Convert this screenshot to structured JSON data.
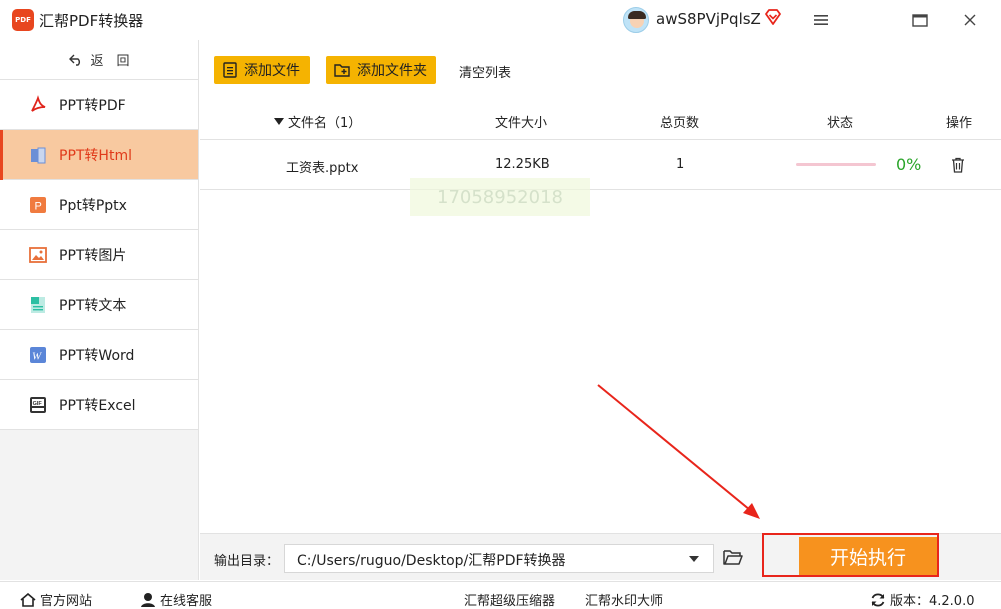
{
  "app": {
    "title": "汇帮PDF转换器",
    "logo_text": "PDF"
  },
  "user": {
    "name": "awS8PVjPqlsZ"
  },
  "sidebar": {
    "back_label": "返　回",
    "items": [
      {
        "label": "PPT转PDF",
        "icon": "pdf-icon"
      },
      {
        "label": "PPT转Html",
        "icon": "html-icon",
        "active": true
      },
      {
        "label": "Ppt转Pptx",
        "icon": "pptx-icon"
      },
      {
        "label": "PPT转图片",
        "icon": "image-icon"
      },
      {
        "label": "PPT转文本",
        "icon": "text-icon"
      },
      {
        "label": "PPT转Word",
        "icon": "word-icon"
      },
      {
        "label": "PPT转Excel",
        "icon": "excel-icon"
      }
    ]
  },
  "toolbar": {
    "add_file": "添加文件",
    "add_folder": "添加文件夹",
    "clear_list": "清空列表"
  },
  "table": {
    "headers": {
      "name": "文件名（1）",
      "size": "文件大小",
      "pages": "总页数",
      "status": "状态",
      "action": "操作"
    },
    "rows": [
      {
        "name": "工资表.pptx",
        "size": "12.25KB",
        "pages": "1",
        "progress": 0,
        "percent": "0%"
      }
    ]
  },
  "watermark": "17058952018",
  "output": {
    "label": "输出目录：",
    "path": "C:/Users/ruguo/Desktop/汇帮PDF转换器"
  },
  "start_button": "开始执行",
  "footer": {
    "website": "官方网站",
    "support": "在线客服",
    "compressor": "汇帮超级压缩器",
    "watermark_tool": "汇帮水印大师",
    "version": "版本：4.2.0.0"
  },
  "colors": {
    "accent": "#f5b301",
    "brand": "#e8461f",
    "start": "#f7921e",
    "active_bg": "#f8c9a0",
    "progress_ok": "#2aa52a"
  }
}
